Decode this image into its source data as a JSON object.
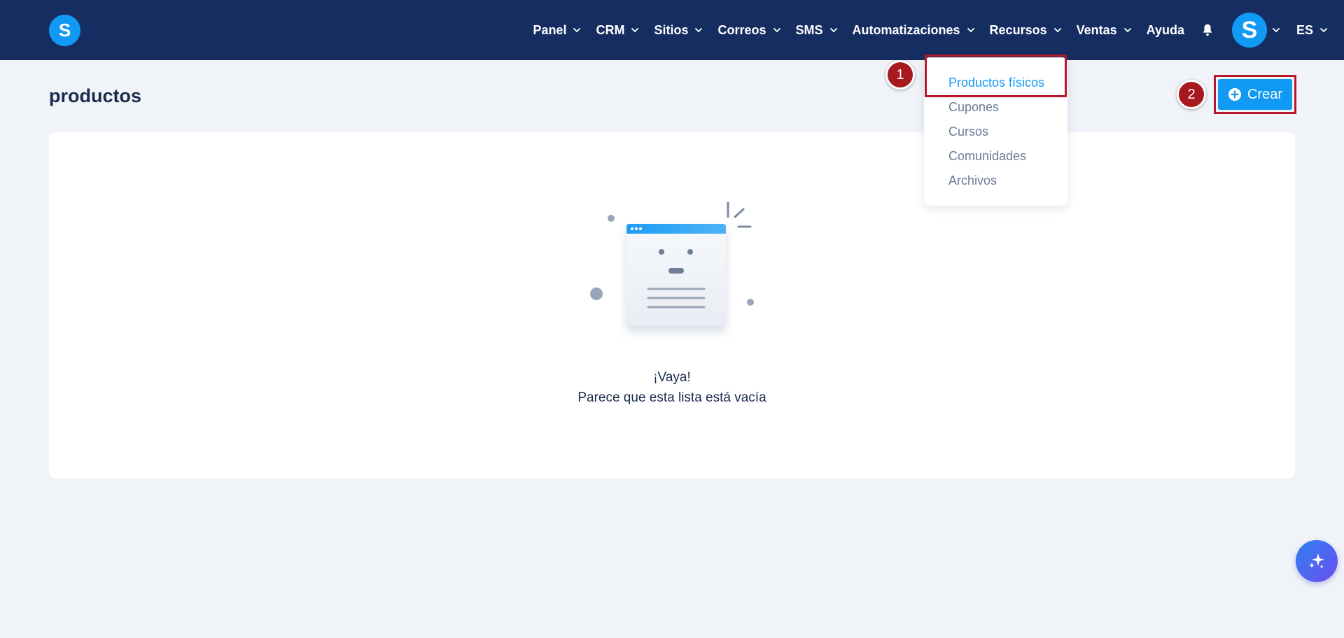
{
  "brand": {
    "logo_letter": "S"
  },
  "nav": {
    "items": [
      {
        "label": "Panel"
      },
      {
        "label": "CRM"
      },
      {
        "label": "Sitios"
      },
      {
        "label": "Correos"
      },
      {
        "label": "SMS"
      },
      {
        "label": "Automatizaciones"
      },
      {
        "label": "Recursos"
      },
      {
        "label": "Ventas"
      }
    ],
    "help_label": "Ayuda",
    "avatar_letter": "S",
    "language": "ES"
  },
  "page": {
    "title": "productos"
  },
  "toolbar": {
    "create_label": "Crear"
  },
  "dropdown": {
    "items": [
      {
        "label": "Productos físicos"
      },
      {
        "label": "Cupones"
      },
      {
        "label": "Cursos"
      },
      {
        "label": "Comunidades"
      },
      {
        "label": "Archivos"
      }
    ]
  },
  "annotations": {
    "step1": "1",
    "step2": "2"
  },
  "empty_state": {
    "title": "¡Vaya!",
    "subtitle": "Parece que esta lista está vacía"
  },
  "colors": {
    "topbar": "#162d62",
    "accent": "#109af4",
    "highlight": "#b5182b"
  }
}
